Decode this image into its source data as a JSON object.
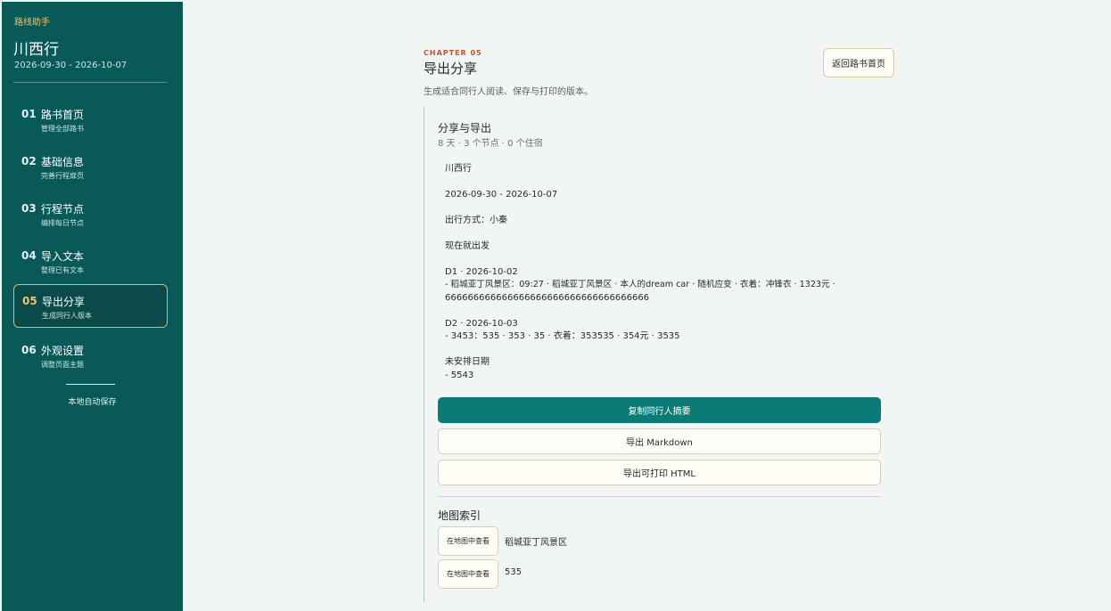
{
  "sidebar": {
    "brand": "路线助手",
    "trip_title": "川西行",
    "trip_dates": "2026-09-30 - 2026-10-07",
    "items": [
      {
        "num": "01",
        "label": "路书首页",
        "sub": "管理全部路书"
      },
      {
        "num": "02",
        "label": "基础信息",
        "sub": "完善行程扉页"
      },
      {
        "num": "03",
        "label": "行程节点",
        "sub": "编排每日节点"
      },
      {
        "num": "04",
        "label": "导入文本",
        "sub": "整理已有文本"
      },
      {
        "num": "05",
        "label": "导出分享",
        "sub": "生成同行人版本",
        "active": true
      },
      {
        "num": "06",
        "label": "外观设置",
        "sub": "调整页面主题"
      }
    ],
    "autosave": "本地自动保存"
  },
  "main": {
    "chapter": "CHAPTER 05",
    "title": "导出分享",
    "description": "生成适合同行人阅读、保存与打印的版本。",
    "back_button": "返回路书首页",
    "panel": {
      "title": "分享与导出",
      "subtitle": "8 天 · 3 个节点 · 0 个住宿",
      "preview": [
        "川西行",
        "2026-09-30 - 2026-10-07",
        "出行方式：小秦",
        "现在就出发",
        "D1 · 2026-10-02",
        "- 稻城亚丁风景区：09:27 · 稻城亚丁风景区 · 本人的dream car · 随机应变 · 衣着：冲锋衣 · 1323元 ·",
        "666666666666666666666666666666666666",
        "D2 · 2026-10-03",
        "- 3453：535 · 353 · 35 · 衣着：353535 · 354元 · 3535",
        "未安排日期",
        "- 5543"
      ],
      "buttons": {
        "copy": "复制同行人摘要",
        "markdown": "导出 Markdown",
        "html": "导出可打印 HTML"
      },
      "map_index": {
        "title": "地图索引",
        "view_label": "在地图中查看",
        "places": [
          "稻城亚丁风景区",
          "535"
        ]
      }
    }
  },
  "colors": {
    "sidebar_bg": "#075a58",
    "accent_gold": "#e3b85a",
    "primary_button": "#0b7b75",
    "chapter_label": "#c8522a"
  }
}
